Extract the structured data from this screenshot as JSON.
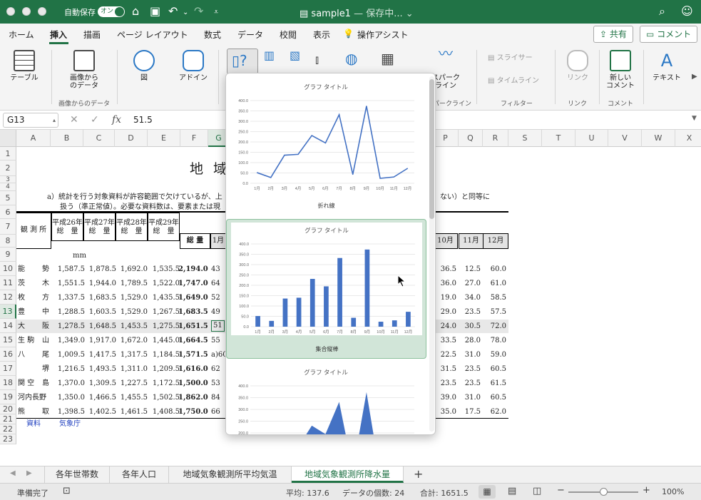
{
  "titlebar": {
    "autosave_label": "自動保存",
    "autosave_state": "オン",
    "doc_name": "sample1",
    "doc_status": "— 保存中..."
  },
  "menu": {
    "items": [
      "ホーム",
      "挿入",
      "描画",
      "ページ レイアウト",
      "数式",
      "データ",
      "校閲",
      "表示",
      "操作アシスト"
    ],
    "active": "挿入",
    "share": "共有",
    "comment": "コメント"
  },
  "ribbon": {
    "table": "テーブル",
    "image_from_data": [
      "画像から",
      "のデータ"
    ],
    "group_image_from_data": "画像からのデータ",
    "figure": "図",
    "addin": "アドイン",
    "sparkline": [
      "スパーク",
      "ライン"
    ],
    "group_sparkline": "スパークライン",
    "slicer": "スライサー",
    "timeline": "タイムライン",
    "group_filter": "フィルター",
    "link": "リンク",
    "group_link": "リンク",
    "new_comment": [
      "新しい",
      "コメント"
    ],
    "group_comment": "コメント",
    "text": "テキスト"
  },
  "formula_bar": {
    "name_box": "G13",
    "fx": "fx",
    "value": "51.5"
  },
  "columns": [
    "A",
    "B",
    "C",
    "D",
    "E",
    "F",
    "G",
    "H",
    "I",
    "J",
    "K",
    "L",
    "M",
    "N",
    "O",
    "P",
    "Q",
    "R",
    "S",
    "T",
    "U",
    "V",
    "W",
    "X"
  ],
  "selected_column": "G",
  "rows": [
    "1",
    "2",
    "3",
    "4",
    "5",
    "6",
    "7",
    "8",
    "9",
    "10",
    "11",
    "12",
    "13",
    "14",
    "15",
    "16",
    "17",
    "18",
    "19",
    "20",
    "21",
    "22",
    "23"
  ],
  "selected_row": "13",
  "sheet": {
    "title": "地 域",
    "note_line1": "a）統計を行う対象資料が許容範囲で欠けているが、上",
    "note_line1_tail": "ない）と同等に",
    "note_line2": "扱う（準正常値）。必要な資料数は、要素または現",
    "hdr_station": "観 測 所",
    "hdr_years": [
      [
        "平成26年",
        "総　量"
      ],
      [
        "平成27年",
        "総　量"
      ],
      [
        "平成28年",
        "総　量"
      ],
      [
        "平成29年",
        "総　量"
      ]
    ],
    "hdr_total": "総 量",
    "hdr_months_left": [
      "1月"
    ],
    "hdr_months_right": [
      "10月",
      "11月",
      "12月"
    ],
    "unit": "mm",
    "data_rows": [
      {
        "station": [
          "能",
          "勢"
        ],
        "y26": "1,587.5",
        "y27": "1,878.5",
        "y28": "1,692.0",
        "y29": "1,535.5",
        "total": "2,194.0",
        "jan": "43",
        "oct": "36.5",
        "nov": "12.5",
        "dec": "60.0"
      },
      {
        "station": [
          "茨",
          "木"
        ],
        "y26": "1,551.5",
        "y27": "1,944.0",
        "y28": "1,789.5",
        "y29": "1,522.0",
        "total": "1,747.0",
        "jan": "64",
        "oct": "36.0",
        "nov": "27.0",
        "dec": "61.0"
      },
      {
        "station": [
          "枚",
          "方"
        ],
        "y26": "1,337.5",
        "y27": "1,683.5",
        "y28": "1,529.0",
        "y29": "1,435.5",
        "total": "1,649.0",
        "jan": "52",
        "oct": "19.0",
        "nov": "34.0",
        "dec": "58.5"
      },
      {
        "station": [
          "豊",
          "中"
        ],
        "y26": "1,288.5",
        "y27": "1,603.5",
        "y28": "1,529.0",
        "y29": "1,267.5",
        "total": "1,683.5",
        "jan": "49",
        "oct": "29.0",
        "nov": "23.5",
        "dec": "57.5"
      },
      {
        "station": [
          "大",
          "阪"
        ],
        "y26": "1,278.5",
        "y27": "1,648.5",
        "y28": "1,453.5",
        "y29": "1,275.5",
        "total": "1,651.5",
        "jan": "51",
        "oct": "24.0",
        "nov": "30.5",
        "dec": "72.0"
      },
      {
        "station": [
          "生 駒",
          "山"
        ],
        "y26": "1,349.0",
        "y27": "1,917.0",
        "y28": "1,672.0",
        "y29": "1,445.0",
        "total": "1,664.5",
        "jan": "55",
        "oct": "33.5",
        "nov": "28.0",
        "dec": "78.0"
      },
      {
        "station": [
          "八",
          "尾"
        ],
        "y26": "1,009.5",
        "y27": "1,417.5",
        "y28": "1,317.5",
        "y29": "1,184.5",
        "total": "1,571.5",
        "jan": "a)60",
        "oct": "22.5",
        "nov": "31.0",
        "dec": "59.0"
      },
      {
        "station": [
          "",
          "堺"
        ],
        "y26": "1,216.5",
        "y27": "1,493.5",
        "y28": "1,311.0",
        "y29": "1,209.5",
        "total": "1,616.0",
        "jan": "62",
        "oct": "31.5",
        "nov": "23.5",
        "dec": "60.5"
      },
      {
        "station": [
          "関 空",
          "島"
        ],
        "y26": "1,370.0",
        "y27": "1,309.5",
        "y28": "1,227.5",
        "y29": "1,172.5",
        "total": "1,500.0",
        "jan": "53",
        "oct": "23.5",
        "nov": "23.5",
        "dec": "61.5"
      },
      {
        "station": [
          "河内長野",
          ""
        ],
        "y26": "1,350.0",
        "y27": "1,466.5",
        "y28": "1,455.5",
        "y29": "1,502.5",
        "total": "1,862.0",
        "jan": "84",
        "oct": "39.0",
        "nov": "31.0",
        "dec": "60.5"
      },
      {
        "station": [
          "熊",
          "取"
        ],
        "y26": "1,398.5",
        "y27": "1,402.5",
        "y28": "1,461.5",
        "y29": "1,408.5",
        "total": "1,750.0",
        "jan": "66",
        "oct": "35.0",
        "nov": "17.5",
        "dec": "62.0"
      }
    ],
    "source_label": "資料",
    "source_value": "気象庁"
  },
  "colors": {
    "accent": "#217346",
    "series": "#4472c4",
    "selection": "#d1e5d8"
  },
  "popup": {
    "options": [
      {
        "label": "折れ線",
        "chart_title": "グラフ タイトル"
      },
      {
        "label": "集合縦棒",
        "chart_title": "グラフ タイトル"
      },
      {
        "label": "",
        "chart_title": "グラフ タイトル"
      }
    ]
  },
  "chart_data": [
    {
      "type": "line",
      "title": "グラフ タイトル",
      "categories": [
        "1月",
        "2月",
        "3月",
        "4月",
        "5月",
        "6月",
        "7月",
        "8月",
        "9月",
        "10月",
        "11月",
        "12月"
      ],
      "values": [
        51.5,
        28.0,
        136.0,
        140.0,
        231.0,
        195.0,
        332.0,
        43.0,
        373.0,
        24.0,
        30.5,
        72.0
      ],
      "ylim": [
        0,
        400
      ],
      "yticks": [
        "400.0",
        "350.0",
        "300.0",
        "250.0",
        "200.0",
        "150.0",
        "100.0",
        "50.0",
        "0.0"
      ],
      "grid": true
    },
    {
      "type": "bar",
      "title": "グラフ タイトル",
      "categories": [
        "1月",
        "2月",
        "3月",
        "4月",
        "5月",
        "6月",
        "7月",
        "8月",
        "9月",
        "10月",
        "11月",
        "12月"
      ],
      "values": [
        51.5,
        28.0,
        136.0,
        140.0,
        231.0,
        195.0,
        332.0,
        43.0,
        373.0,
        24.0,
        30.5,
        72.0
      ],
      "ylim": [
        0,
        400
      ],
      "yticks": [
        "400.0",
        "350.0",
        "300.0",
        "250.0",
        "200.0",
        "150.0",
        "100.0",
        "50.0",
        "0.0"
      ],
      "grid": true
    },
    {
      "type": "area",
      "title": "グラフ タイトル",
      "categories": [
        "1月",
        "2月",
        "3月",
        "4月",
        "5月",
        "6月",
        "7月",
        "8月",
        "9月",
        "10月",
        "11月",
        "12月"
      ],
      "values": [
        51.5,
        28.0,
        136.0,
        140.0,
        231.0,
        195.0,
        332.0,
        43.0,
        373.0,
        24.0,
        30.5,
        72.0
      ],
      "ylim": [
        0,
        400
      ],
      "yticks": [
        "400.0",
        "350.0",
        "300.0",
        "250.0",
        "200.0"
      ],
      "grid": true
    }
  ],
  "sheet_tabs": [
    "各年世帯数",
    "各年人口",
    "地域気象観測所平均気温",
    "地域気象観測所降水量"
  ],
  "active_tab": "地域気象観測所降水量",
  "status": {
    "ready": "準備完了",
    "average": "平均: 137.6",
    "count": "データの個数: 24",
    "sum": "合計: 1651.5",
    "zoom": "100%",
    "zoom_level": 1.0
  }
}
